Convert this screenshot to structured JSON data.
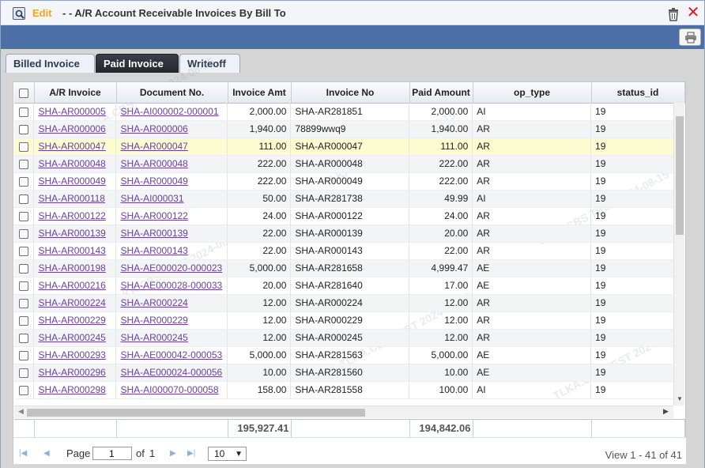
{
  "window": {
    "edit_label": "Edit",
    "title": "- - A/R Account Receivable Invoices By Bill To"
  },
  "tabs": [
    {
      "label": "Billed Invoice"
    },
    {
      "label": "Paid Invoice"
    },
    {
      "label": "Writeoff"
    }
  ],
  "grid": {
    "columns": [
      "A/R Invoice",
      "Document No.",
      "Invoice Amt",
      "Invoice No",
      "Paid Amount",
      "op_type",
      "status_id"
    ],
    "rows": [
      {
        "ar": "SHA-AR000005",
        "doc": "SHA-AI000002-000001",
        "amt": "2,000.00",
        "inv": "SHA-AR281851",
        "paid": "2,000.00",
        "op": "AI",
        "status": "19"
      },
      {
        "ar": "SHA-AR000006",
        "doc": "SHA-AR000006",
        "amt": "1,940.00",
        "inv": "78899wwq9",
        "paid": "1,940.00",
        "op": "AR",
        "status": "19"
      },
      {
        "ar": "SHA-AR000047",
        "doc": "SHA-AR000047",
        "amt": "111.00",
        "inv": "SHA-AR000047",
        "paid": "111.00",
        "op": "AR",
        "status": "19"
      },
      {
        "ar": "SHA-AR000048",
        "doc": "SHA-AR000048",
        "amt": "222.00",
        "inv": "SHA-AR000048",
        "paid": "222.00",
        "op": "AR",
        "status": "19"
      },
      {
        "ar": "SHA-AR000049",
        "doc": "SHA-AR000049",
        "amt": "222.00",
        "inv": "SHA-AR000049",
        "paid": "222.00",
        "op": "AR",
        "status": "19"
      },
      {
        "ar": "SHA-AR000118",
        "doc": "SHA-AI000031",
        "amt": "50.00",
        "inv": "SHA-AR281738",
        "paid": "49.99",
        "op": "AI",
        "status": "19"
      },
      {
        "ar": "SHA-AR000122",
        "doc": "SHA-AR000122",
        "amt": "24.00",
        "inv": "SHA-AR000122",
        "paid": "24.00",
        "op": "AR",
        "status": "19"
      },
      {
        "ar": "SHA-AR000139",
        "doc": "SHA-AR000139",
        "amt": "22.00",
        "inv": "SHA-AR000139",
        "paid": "20.00",
        "op": "AR",
        "status": "19"
      },
      {
        "ar": "SHA-AR000143",
        "doc": "SHA-AR000143",
        "amt": "22.00",
        "inv": "SHA-AR000143",
        "paid": "22.00",
        "op": "AR",
        "status": "19"
      },
      {
        "ar": "SHA-AR000198",
        "doc": "SHA-AE000020-000023",
        "amt": "5,000.00",
        "inv": "SHA-AR281658",
        "paid": "4,999.47",
        "op": "AE",
        "status": "19"
      },
      {
        "ar": "SHA-AR000216",
        "doc": "SHA-AE000028-000033",
        "amt": "20.00",
        "inv": "SHA-AR281640",
        "paid": "17.00",
        "op": "AE",
        "status": "19"
      },
      {
        "ar": "SHA-AR000224",
        "doc": "SHA-AR000224",
        "amt": "12.00",
        "inv": "SHA-AR000224",
        "paid": "12.00",
        "op": "AR",
        "status": "19"
      },
      {
        "ar": "SHA-AR000229",
        "doc": "SHA-AR000229",
        "amt": "12.00",
        "inv": "SHA-AR000229",
        "paid": "12.00",
        "op": "AR",
        "status": "19"
      },
      {
        "ar": "SHA-AR000245",
        "doc": "SHA-AR000245",
        "amt": "12.00",
        "inv": "SHA-AR000245",
        "paid": "12.00",
        "op": "AR",
        "status": "19"
      },
      {
        "ar": "SHA-AR000293",
        "doc": "SHA-AE000042-000053",
        "amt": "5,000.00",
        "inv": "SHA-AR281563",
        "paid": "5,000.00",
        "op": "AE",
        "status": "19"
      },
      {
        "ar": "SHA-AR000296",
        "doc": "SHA-AE000024-000056",
        "amt": "10.00",
        "inv": "SHA-AR281560",
        "paid": "10.00",
        "op": "AE",
        "status": "19"
      },
      {
        "ar": "SHA-AR000298",
        "doc": "SHA-AI000070-000058",
        "amt": "158.00",
        "inv": "SHA-AR281558",
        "paid": "100.00",
        "op": "AI",
        "status": "19"
      }
    ],
    "totals": {
      "invoice_amt": "195,927.41",
      "paid_amount": "194,842.06"
    }
  },
  "pager": {
    "page_label": "Page",
    "page_value": "1",
    "of_label": "of",
    "total_pages": "1",
    "page_size": "10",
    "view_text": "View 1 - 41 of 41"
  },
  "watermark": "TLKA.CBS.TEST 2024-08-15",
  "colors": {
    "header_blue": "#4c6fa8",
    "edit_orange": "#f0a22a",
    "link_purple": "#6a3fa0",
    "highlight_row": "#fdfbd0",
    "close_red": "#d42020"
  }
}
